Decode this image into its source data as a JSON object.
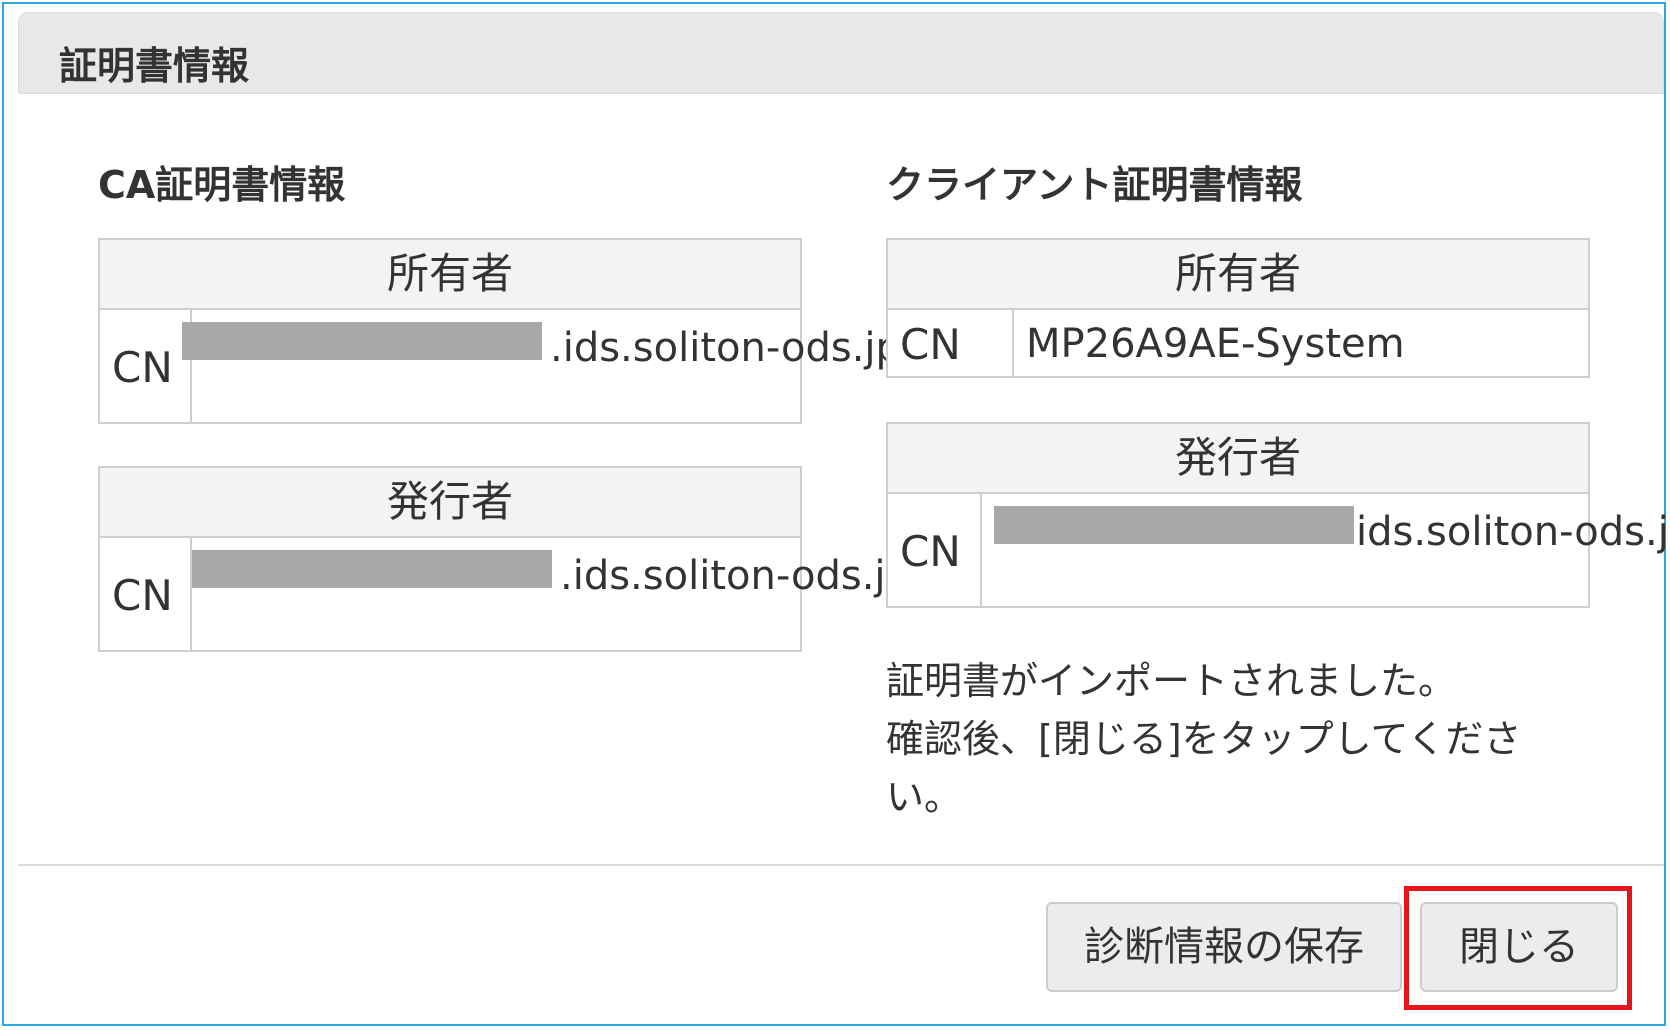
{
  "dialog": {
    "title": "証明書情報"
  },
  "ca_section": {
    "title": "CA証明書情報",
    "owner": {
      "header": "所有者",
      "label": "CN",
      "value_visible": ".ids.soliton-ods.jp"
    },
    "issuer": {
      "header": "発行者",
      "label": "CN",
      "value_visible": ".ids.soliton-ods.jp"
    }
  },
  "client_section": {
    "title": "クライアント証明書情報",
    "owner": {
      "header": "所有者",
      "label": "CN",
      "value": "MP26A9AE-System"
    },
    "issuer": {
      "header": "発行者",
      "label": "CN",
      "value_visible": "ids.soliton-ods.jp"
    }
  },
  "message": {
    "line1": "証明書がインポートされました。",
    "line2": "確認後、[閉じる]をタップしてくださ",
    "line3": "い。"
  },
  "buttons": {
    "save_diagnostics": "診断情報の保存",
    "close": "閉じる"
  },
  "colors": {
    "frame_border": "#29a9e0",
    "highlight": "#e8141b"
  }
}
